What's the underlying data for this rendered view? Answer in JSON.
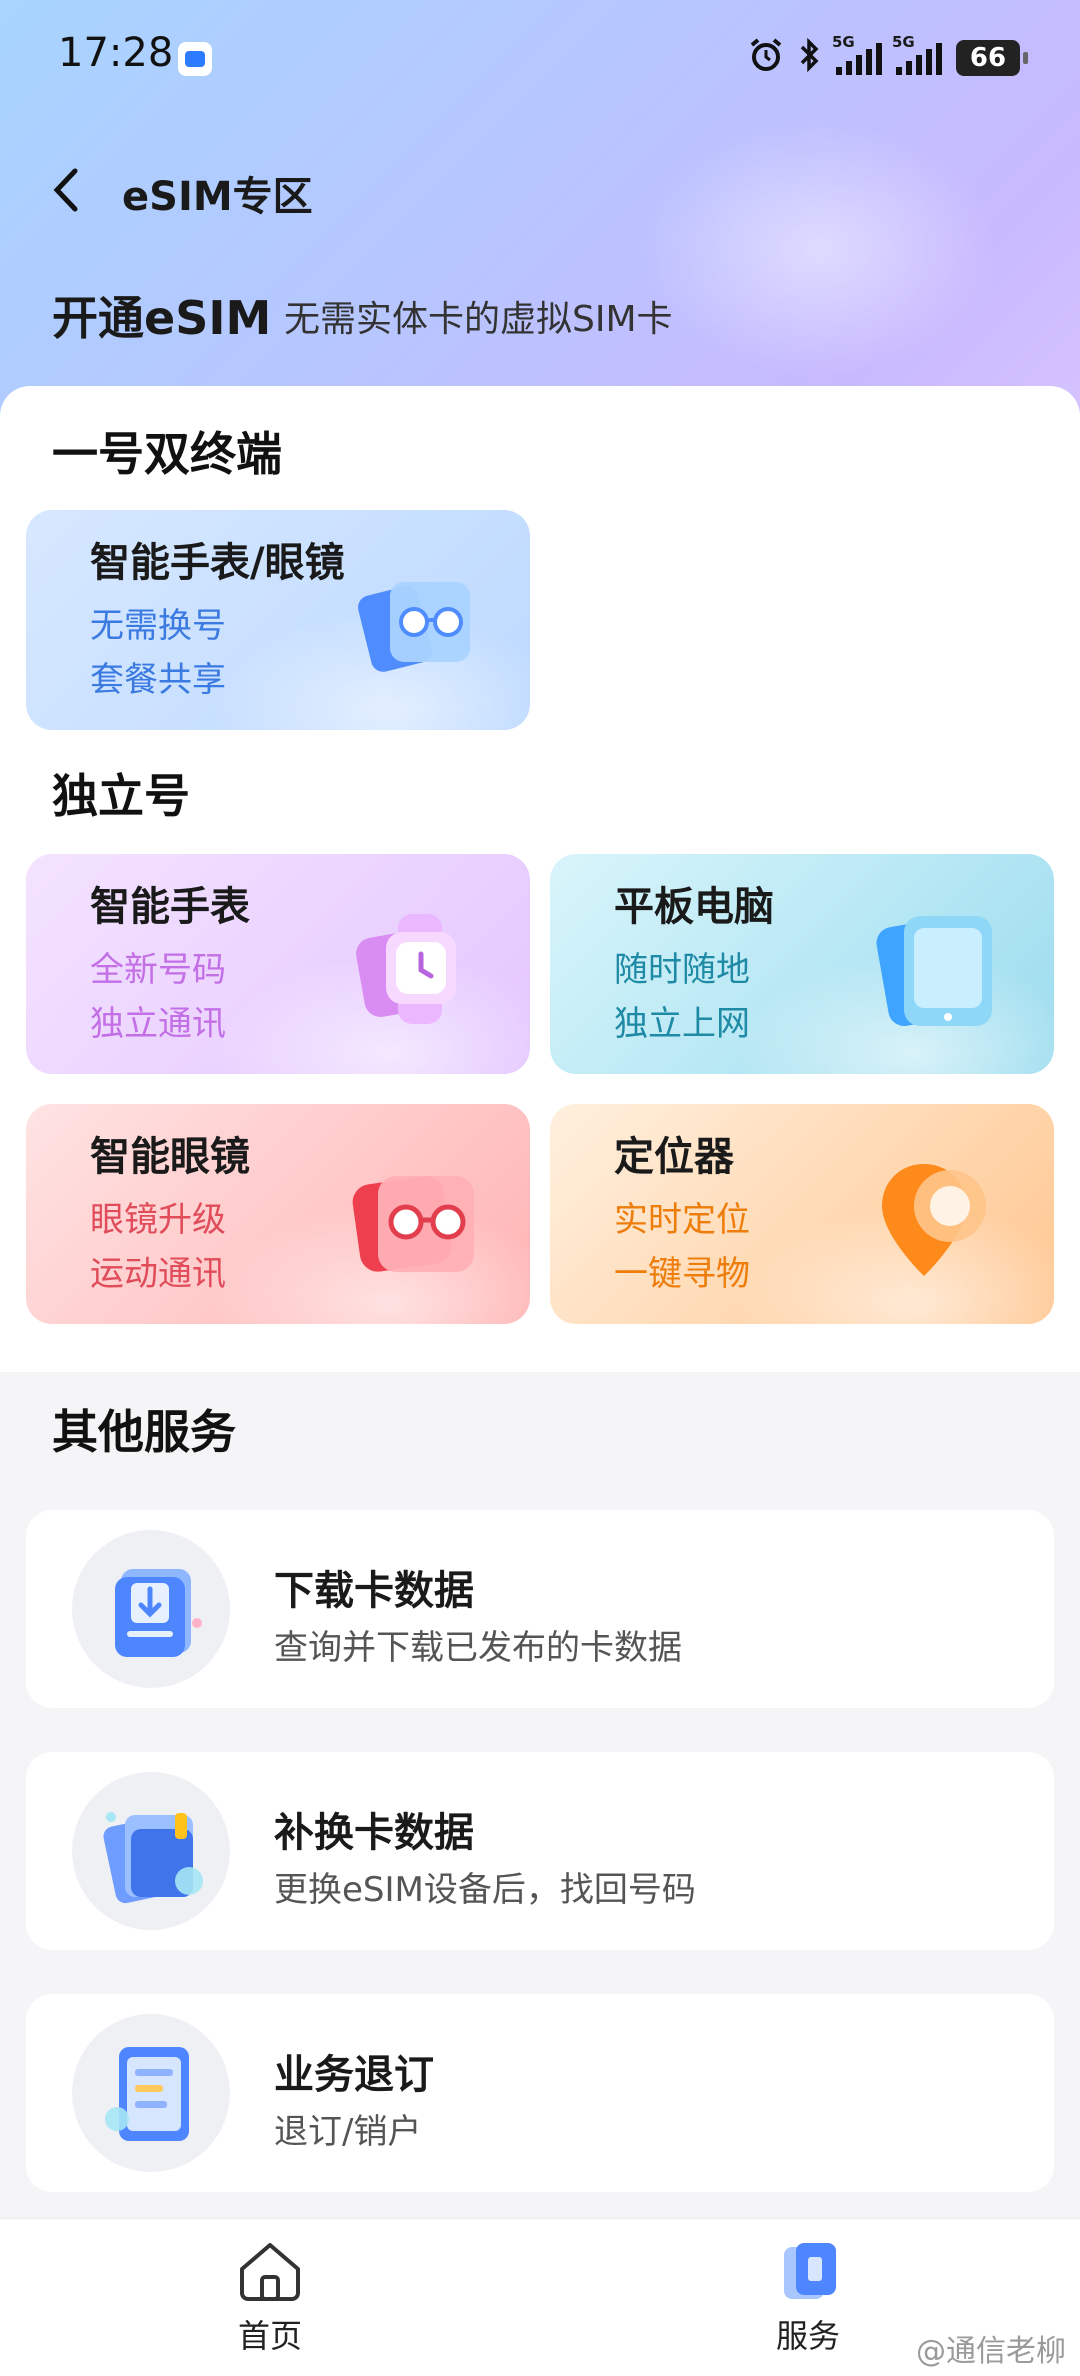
{
  "status_bar": {
    "time": "17:28",
    "battery": "66",
    "network_tag": "5G"
  },
  "header": {
    "title": "eSIM专区"
  },
  "hero": {
    "title": "开通eSIM",
    "subtitle": "无需实体卡的虚拟SIM卡"
  },
  "sections": {
    "dual_terminal": "一号双终端",
    "standalone": "独立号",
    "other_services": "其他服务"
  },
  "cards": {
    "watch_glasses": {
      "title": "智能手表/眼镜",
      "line1": "无需换号",
      "line2": "套餐共享"
    },
    "watch": {
      "title": "智能手表",
      "line1": "全新号码",
      "line2": "独立通讯"
    },
    "tablet": {
      "title": "平板电脑",
      "line1": "随时随地",
      "line2": "独立上网"
    },
    "glasses": {
      "title": "智能眼镜",
      "line1": "眼镜升级",
      "line2": "运动通讯"
    },
    "locator": {
      "title": "定位器",
      "line1": "实时定位",
      "line2": "一键寻物"
    }
  },
  "services": [
    {
      "title": "下载卡数据",
      "desc": "查询并下载已发布的卡数据",
      "icon": "download-icon"
    },
    {
      "title": "补换卡数据",
      "desc": "更换eSIM设备后，找回号码",
      "icon": "card-replace-icon"
    },
    {
      "title": "业务退订",
      "desc": "退订/销户",
      "icon": "unsubscribe-icon"
    }
  ],
  "bottom_nav": {
    "home": "首页",
    "service": "服务"
  },
  "watermark": "@通信老柳"
}
